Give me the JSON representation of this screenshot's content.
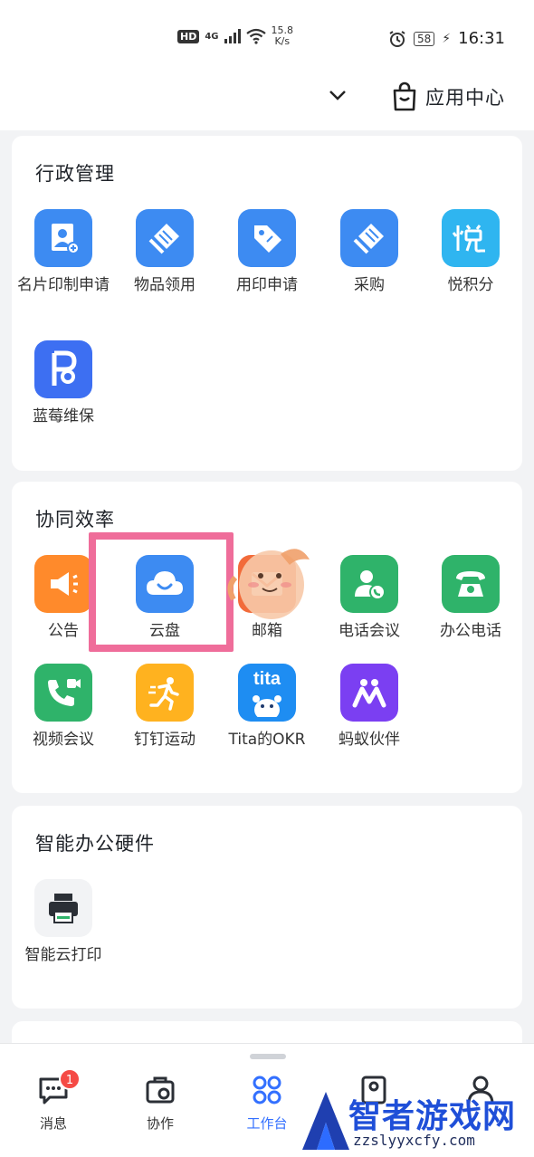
{
  "status_bar": {
    "hd": "HD",
    "network": "4G",
    "speed_value": "15.8",
    "speed_unit": "K/s",
    "battery": "58",
    "time": "16:31"
  },
  "top_nav": {
    "app_center_label": "应用中心"
  },
  "sections": {
    "admin": {
      "title": "行政管理",
      "apps": [
        {
          "label": "名片印制申请",
          "icon": "business-card-icon",
          "color": "#3d8bf2"
        },
        {
          "label": "物品领用",
          "icon": "items-icon",
          "color": "#3d8bf2"
        },
        {
          "label": "用印申请",
          "icon": "tag-icon",
          "color": "#3d8bf2"
        },
        {
          "label": "采购",
          "icon": "purchase-icon",
          "color": "#3d8bf2"
        },
        {
          "label": "悦积分",
          "icon": "points-icon",
          "color": "#2fb5f0"
        },
        {
          "label": "蓝莓维保",
          "icon": "blueberry-icon",
          "color": "#3d6ff2"
        }
      ]
    },
    "collab": {
      "title": "协同效率",
      "apps": [
        {
          "label": "公告",
          "icon": "megaphone-icon",
          "color": "#ff8a2b"
        },
        {
          "label": "云盘",
          "icon": "cloud-icon",
          "color": "#3d8bf2"
        },
        {
          "label": "邮箱",
          "icon": "mail-icon",
          "color": "#f26b3a"
        },
        {
          "label": "电话会议",
          "icon": "phone-conference-icon",
          "color": "#2fb36a"
        },
        {
          "label": "办公电话",
          "icon": "desk-phone-icon",
          "color": "#2fb36a"
        },
        {
          "label": "视频会议",
          "icon": "video-call-icon",
          "color": "#2fb36a"
        },
        {
          "label": "钉钉运动",
          "icon": "running-icon",
          "color": "#ffb21f"
        },
        {
          "label": "Tita的OKR",
          "icon": "tita-icon",
          "color": "#1e8df2"
        },
        {
          "label": "蚂蚁伙伴",
          "icon": "ant-partner-icon",
          "color": "#7b3ff2"
        }
      ]
    },
    "hardware": {
      "title": "智能办公硬件",
      "apps": [
        {
          "label": "智能云打印",
          "icon": "printer-icon",
          "color": "#f2f3f5"
        }
      ]
    }
  },
  "tita_text": "tita",
  "bottom_tabs": [
    {
      "label": "消息",
      "icon": "message-icon",
      "badge": "1"
    },
    {
      "label": "协作",
      "icon": "collaboration-icon"
    },
    {
      "label": "工作台",
      "icon": "workbench-icon"
    },
    {
      "label": "",
      "icon": "contacts-icon"
    },
    {
      "label": "",
      "icon": "profile-icon"
    }
  ],
  "watermark": {
    "title": "智者游戏网",
    "url": "zzslyyxcfy.com"
  },
  "colors": {
    "accent": "#3370ff",
    "highlight": "#ef6d9a",
    "badge": "#f54a45"
  }
}
